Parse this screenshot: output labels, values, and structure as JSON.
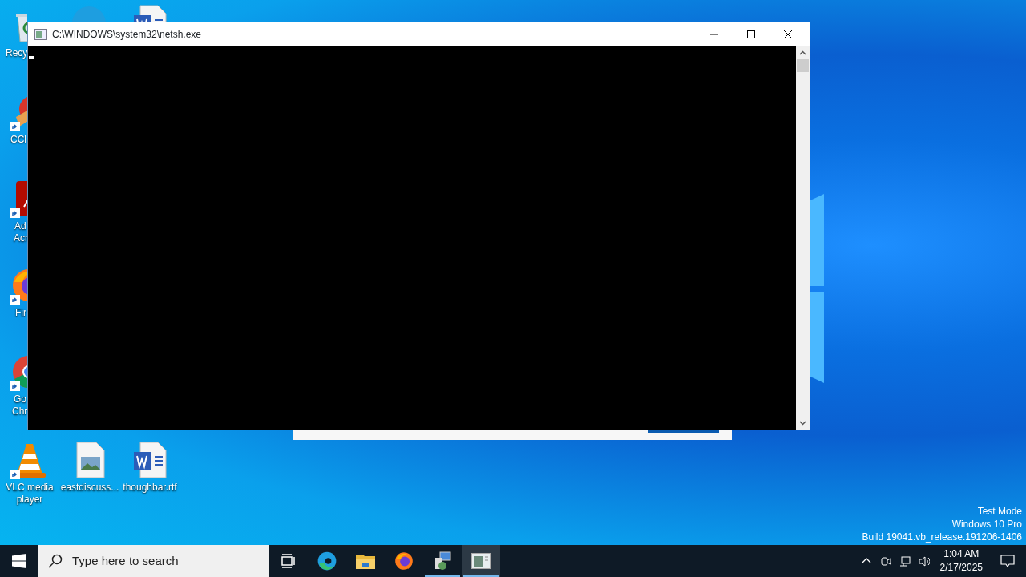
{
  "desktop_icons": [
    {
      "kind": "recycle",
      "shortcut": false,
      "lines": [
        "Recy"
      ]
    },
    {
      "kind": "ccleaner",
      "shortcut": true,
      "lines": [
        "CCl"
      ]
    },
    {
      "kind": "acrobat",
      "shortcut": true,
      "lines": [
        "Ad",
        "Acr"
      ]
    },
    {
      "kind": "firefox",
      "shortcut": true,
      "lines": [
        "Fir"
      ]
    },
    {
      "kind": "chrome",
      "shortcut": true,
      "lines": [
        "Go",
        "Chr"
      ]
    },
    {
      "kind": "vlc",
      "shortcut": true,
      "lines": [
        "VLC media",
        "player"
      ]
    },
    {
      "kind": "image-file",
      "shortcut": false,
      "lines": [
        "eastdiscuss..."
      ]
    },
    {
      "kind": "word-file",
      "shortcut": false,
      "lines": [
        "thoughbar.rtf"
      ]
    }
  ],
  "partial_icons": [
    {
      "kind": "edge"
    },
    {
      "kind": "word-file"
    }
  ],
  "window": {
    "title": "C:\\WINDOWS\\system32\\netsh.exe"
  },
  "desktop_info": [
    "Test Mode",
    "Windows 10 Pro",
    "Build 19041.vb_release.191206-1406"
  ],
  "taskbar": {
    "search": {
      "placeholder": "Type here to search"
    },
    "apps": [
      {
        "kind": "task-view",
        "running": false,
        "active": false
      },
      {
        "kind": "edge",
        "running": false,
        "active": false
      },
      {
        "kind": "folder",
        "running": false,
        "active": false
      },
      {
        "kind": "firefox",
        "running": false,
        "active": false
      },
      {
        "kind": "installer",
        "running": true,
        "active": false
      },
      {
        "kind": "console",
        "running": true,
        "active": true
      }
    ],
    "clock": {
      "time": "1:04 AM",
      "date": "2/17/2025"
    }
  }
}
